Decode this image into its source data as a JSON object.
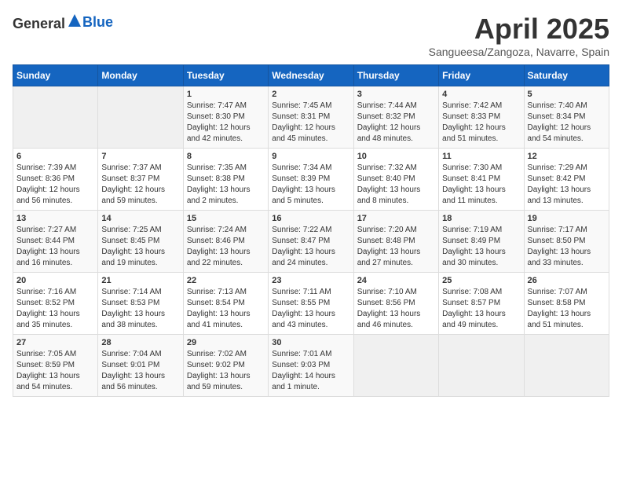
{
  "header": {
    "logo_general": "General",
    "logo_blue": "Blue",
    "title": "April 2025",
    "location": "Sangueesa/Zangoza, Navarre, Spain"
  },
  "weekdays": [
    "Sunday",
    "Monday",
    "Tuesday",
    "Wednesday",
    "Thursday",
    "Friday",
    "Saturday"
  ],
  "weeks": [
    [
      {
        "day": "",
        "info": ""
      },
      {
        "day": "",
        "info": ""
      },
      {
        "day": "1",
        "info": "Sunrise: 7:47 AM\nSunset: 8:30 PM\nDaylight: 12 hours and 42 minutes."
      },
      {
        "day": "2",
        "info": "Sunrise: 7:45 AM\nSunset: 8:31 PM\nDaylight: 12 hours and 45 minutes."
      },
      {
        "day": "3",
        "info": "Sunrise: 7:44 AM\nSunset: 8:32 PM\nDaylight: 12 hours and 48 minutes."
      },
      {
        "day": "4",
        "info": "Sunrise: 7:42 AM\nSunset: 8:33 PM\nDaylight: 12 hours and 51 minutes."
      },
      {
        "day": "5",
        "info": "Sunrise: 7:40 AM\nSunset: 8:34 PM\nDaylight: 12 hours and 54 minutes."
      }
    ],
    [
      {
        "day": "6",
        "info": "Sunrise: 7:39 AM\nSunset: 8:36 PM\nDaylight: 12 hours and 56 minutes."
      },
      {
        "day": "7",
        "info": "Sunrise: 7:37 AM\nSunset: 8:37 PM\nDaylight: 12 hours and 59 minutes."
      },
      {
        "day": "8",
        "info": "Sunrise: 7:35 AM\nSunset: 8:38 PM\nDaylight: 13 hours and 2 minutes."
      },
      {
        "day": "9",
        "info": "Sunrise: 7:34 AM\nSunset: 8:39 PM\nDaylight: 13 hours and 5 minutes."
      },
      {
        "day": "10",
        "info": "Sunrise: 7:32 AM\nSunset: 8:40 PM\nDaylight: 13 hours and 8 minutes."
      },
      {
        "day": "11",
        "info": "Sunrise: 7:30 AM\nSunset: 8:41 PM\nDaylight: 13 hours and 11 minutes."
      },
      {
        "day": "12",
        "info": "Sunrise: 7:29 AM\nSunset: 8:42 PM\nDaylight: 13 hours and 13 minutes."
      }
    ],
    [
      {
        "day": "13",
        "info": "Sunrise: 7:27 AM\nSunset: 8:44 PM\nDaylight: 13 hours and 16 minutes."
      },
      {
        "day": "14",
        "info": "Sunrise: 7:25 AM\nSunset: 8:45 PM\nDaylight: 13 hours and 19 minutes."
      },
      {
        "day": "15",
        "info": "Sunrise: 7:24 AM\nSunset: 8:46 PM\nDaylight: 13 hours and 22 minutes."
      },
      {
        "day": "16",
        "info": "Sunrise: 7:22 AM\nSunset: 8:47 PM\nDaylight: 13 hours and 24 minutes."
      },
      {
        "day": "17",
        "info": "Sunrise: 7:20 AM\nSunset: 8:48 PM\nDaylight: 13 hours and 27 minutes."
      },
      {
        "day": "18",
        "info": "Sunrise: 7:19 AM\nSunset: 8:49 PM\nDaylight: 13 hours and 30 minutes."
      },
      {
        "day": "19",
        "info": "Sunrise: 7:17 AM\nSunset: 8:50 PM\nDaylight: 13 hours and 33 minutes."
      }
    ],
    [
      {
        "day": "20",
        "info": "Sunrise: 7:16 AM\nSunset: 8:52 PM\nDaylight: 13 hours and 35 minutes."
      },
      {
        "day": "21",
        "info": "Sunrise: 7:14 AM\nSunset: 8:53 PM\nDaylight: 13 hours and 38 minutes."
      },
      {
        "day": "22",
        "info": "Sunrise: 7:13 AM\nSunset: 8:54 PM\nDaylight: 13 hours and 41 minutes."
      },
      {
        "day": "23",
        "info": "Sunrise: 7:11 AM\nSunset: 8:55 PM\nDaylight: 13 hours and 43 minutes."
      },
      {
        "day": "24",
        "info": "Sunrise: 7:10 AM\nSunset: 8:56 PM\nDaylight: 13 hours and 46 minutes."
      },
      {
        "day": "25",
        "info": "Sunrise: 7:08 AM\nSunset: 8:57 PM\nDaylight: 13 hours and 49 minutes."
      },
      {
        "day": "26",
        "info": "Sunrise: 7:07 AM\nSunset: 8:58 PM\nDaylight: 13 hours and 51 minutes."
      }
    ],
    [
      {
        "day": "27",
        "info": "Sunrise: 7:05 AM\nSunset: 8:59 PM\nDaylight: 13 hours and 54 minutes."
      },
      {
        "day": "28",
        "info": "Sunrise: 7:04 AM\nSunset: 9:01 PM\nDaylight: 13 hours and 56 minutes."
      },
      {
        "day": "29",
        "info": "Sunrise: 7:02 AM\nSunset: 9:02 PM\nDaylight: 13 hours and 59 minutes."
      },
      {
        "day": "30",
        "info": "Sunrise: 7:01 AM\nSunset: 9:03 PM\nDaylight: 14 hours and 1 minute."
      },
      {
        "day": "",
        "info": ""
      },
      {
        "day": "",
        "info": ""
      },
      {
        "day": "",
        "info": ""
      }
    ]
  ]
}
